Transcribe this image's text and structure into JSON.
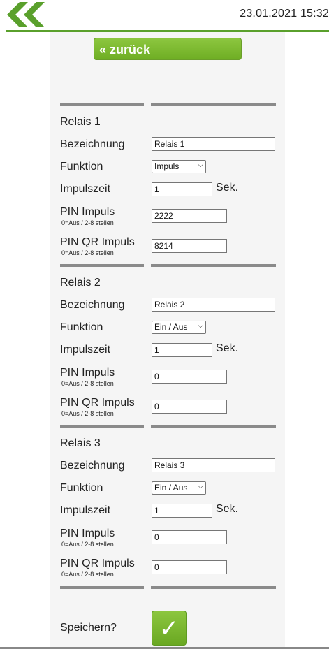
{
  "header": {
    "logo_icon": "double-chevron-left-icon",
    "datetime": "23.01.2021 15:32",
    "accent_color": "#5aa02c"
  },
  "nav": {
    "back_label": "« zurück"
  },
  "relays": [
    {
      "title": "Relais 1",
      "bezeichnung_label": "Bezeichnung",
      "bezeichnung_value": "Relais 1",
      "funktion_label": "Funktion",
      "funktion_value": "Impuls",
      "impulszeit_label": "Impulszeit",
      "impulszeit_value": "1",
      "impulszeit_unit": "Sek.",
      "pin_label": "PIN Impuls",
      "pin_hint": "0=Aus / 2-8 stellen",
      "pin_value": "2222",
      "pinqr_label": "PIN QR Impuls",
      "pinqr_hint": "0=Aus / 2-8 stellen",
      "pinqr_value": "8214"
    },
    {
      "title": "Relais 2",
      "bezeichnung_label": "Bezeichnung",
      "bezeichnung_value": "Relais 2",
      "funktion_label": "Funktion",
      "funktion_value": "Ein / Aus",
      "impulszeit_label": "Impulszeit",
      "impulszeit_value": "1",
      "impulszeit_unit": "Sek.",
      "pin_label": "PIN Impuls",
      "pin_hint": "0=Aus / 2-8 stellen",
      "pin_value": "0",
      "pinqr_label": "PIN QR Impuls",
      "pinqr_hint": "0=Aus / 2-8 stellen",
      "pinqr_value": "0"
    },
    {
      "title": "Relais 3",
      "bezeichnung_label": "Bezeichnung",
      "bezeichnung_value": "Relais 3",
      "funktion_label": "Funktion",
      "funktion_value": "Ein / Aus",
      "impulszeit_label": "Impulszeit",
      "impulszeit_value": "1",
      "impulszeit_unit": "Sek.",
      "pin_label": "PIN Impuls",
      "pin_hint": "0=Aus / 2-8 stellen",
      "pin_value": "0",
      "pinqr_label": "PIN QR Impuls",
      "pinqr_hint": "0=Aus / 2-8 stellen",
      "pinqr_value": "0"
    }
  ],
  "footer": {
    "save_label": "Speichern?",
    "save_icon": "checkmark-icon",
    "save_glyph": "✓"
  }
}
